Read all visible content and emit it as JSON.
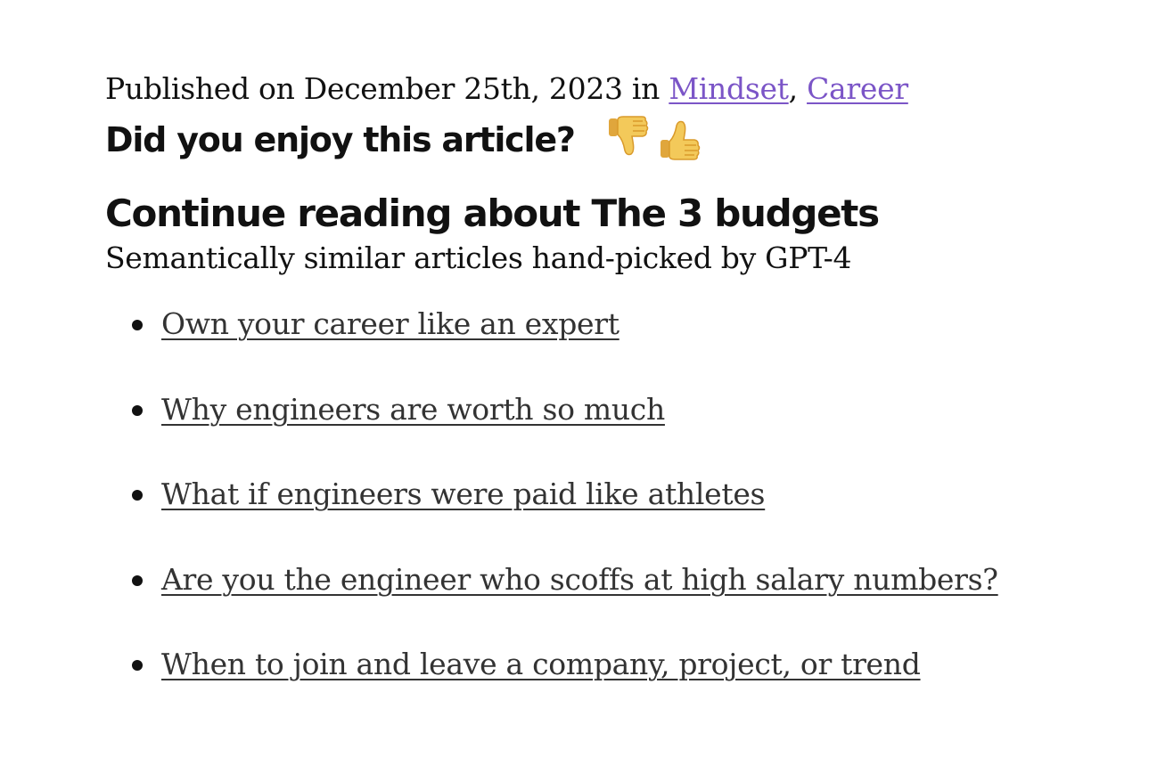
{
  "meta": {
    "published_prefix": "Published on December 25th, 2023 in ",
    "separator": ", ",
    "categories": [
      {
        "label": "Mindset"
      },
      {
        "label": "Career"
      }
    ]
  },
  "feedback": {
    "question": "Did you enjoy this article?",
    "thumbs_down": "👎",
    "thumbs_up": "👍"
  },
  "related": {
    "heading": "Continue reading about The 3 budgets",
    "subtitle": "Semantically similar articles hand-picked by GPT-4",
    "items": [
      {
        "label": "Own your career like an expert"
      },
      {
        "label": "Why engineers are worth so much"
      },
      {
        "label": "What if engineers were paid like athletes"
      },
      {
        "label": "Are you the engineer who scoffs at high salary numbers?"
      },
      {
        "label": "When to join and leave a company, project, or trend"
      }
    ]
  },
  "colors": {
    "link": "#7b55c7",
    "related_link": "#333333",
    "emoji": "#f3c95a"
  }
}
